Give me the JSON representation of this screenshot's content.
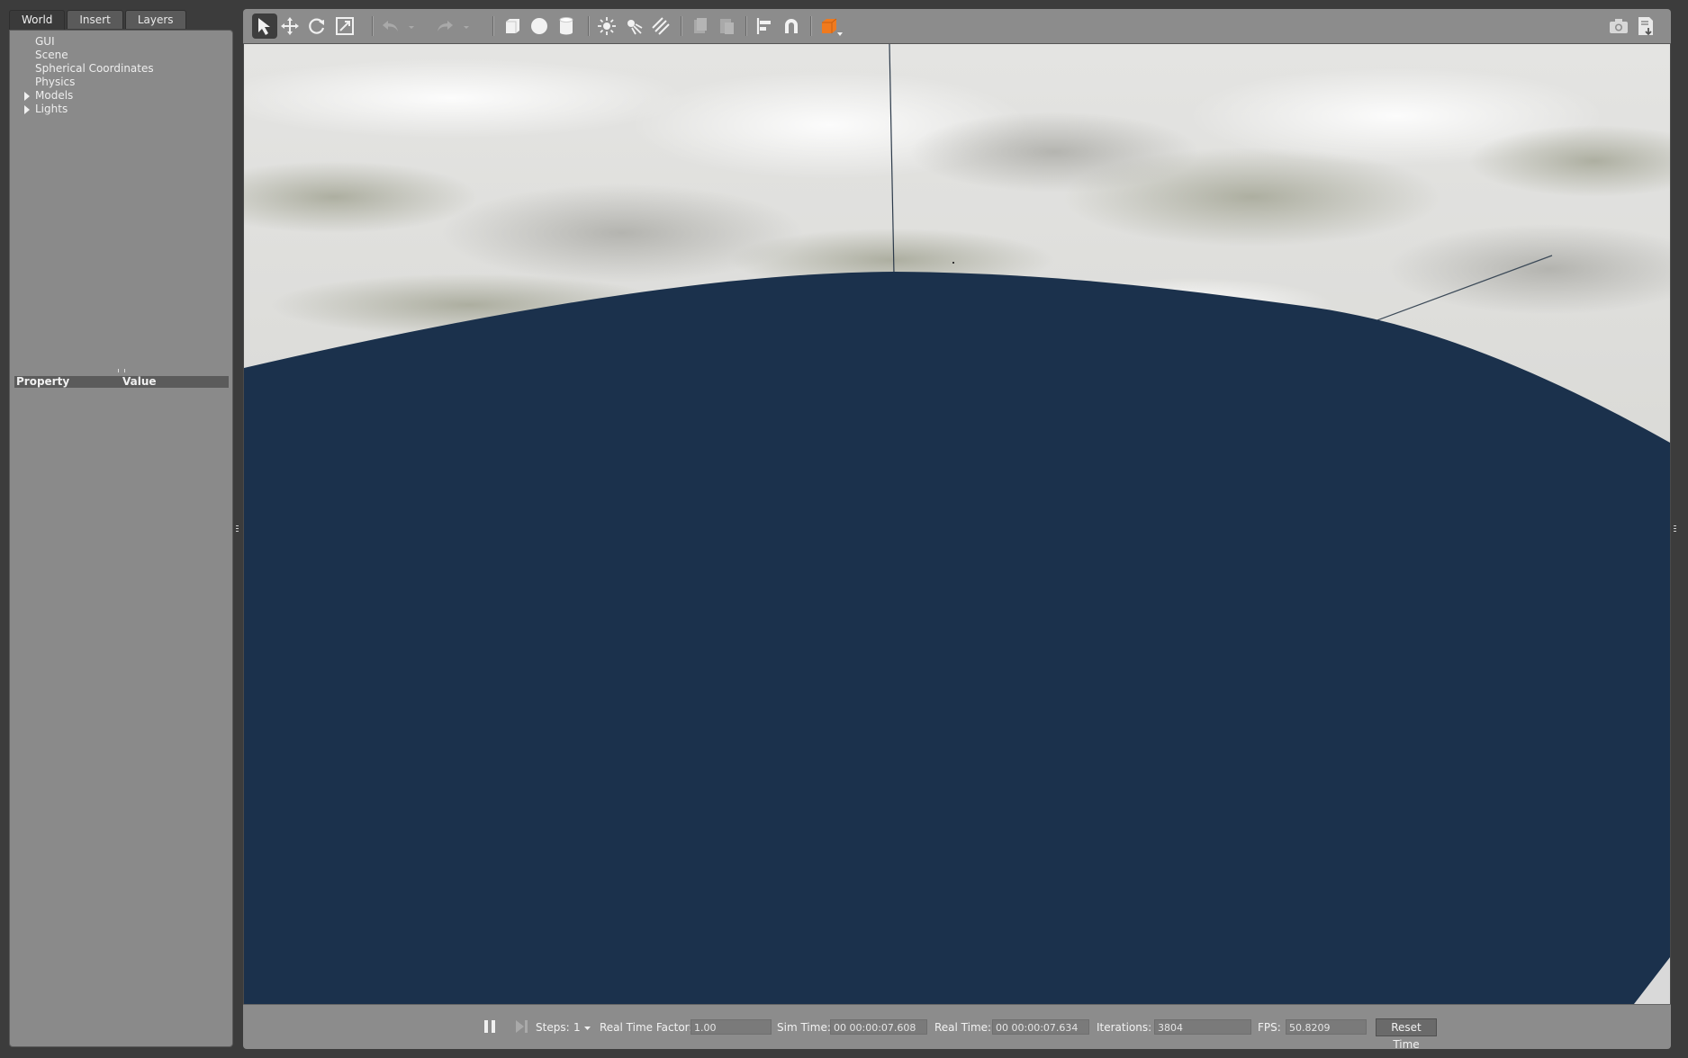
{
  "left_panel": {
    "tabs": [
      {
        "label": "World",
        "active": true
      },
      {
        "label": "Insert",
        "active": false
      },
      {
        "label": "Layers",
        "active": false
      }
    ],
    "tree": [
      {
        "label": "GUI",
        "expandable": false
      },
      {
        "label": "Scene",
        "expandable": false
      },
      {
        "label": "Spherical Coordinates",
        "expandable": false
      },
      {
        "label": "Physics",
        "expandable": false
      },
      {
        "label": "Models",
        "expandable": true
      },
      {
        "label": "Lights",
        "expandable": true
      }
    ],
    "property_header": {
      "property": "Property",
      "value": "Value"
    }
  },
  "toolbar": {
    "tools": [
      {
        "icon": "select-arrow-icon",
        "active": true
      },
      {
        "icon": "translate-icon"
      },
      {
        "icon": "rotate-icon"
      },
      {
        "icon": "scale-icon"
      },
      {
        "icon": "undo-icon"
      },
      {
        "icon": "undo-history-dropdown-icon"
      },
      {
        "icon": "redo-icon"
      },
      {
        "icon": "redo-history-dropdown-icon"
      },
      {
        "icon": "box-shape-icon"
      },
      {
        "icon": "sphere-shape-icon"
      },
      {
        "icon": "cylinder-shape-icon"
      },
      {
        "icon": "point-light-icon"
      },
      {
        "icon": "spot-light-icon"
      },
      {
        "icon": "directional-light-icon"
      },
      {
        "icon": "copy-icon"
      },
      {
        "icon": "paste-icon"
      },
      {
        "icon": "align-icon"
      },
      {
        "icon": "snap-magnet-icon"
      },
      {
        "icon": "view-angle-cube-icon"
      },
      {
        "icon": "screenshot-camera-icon"
      },
      {
        "icon": "log-record-icon"
      }
    ],
    "accent_color": "#f07a1e"
  },
  "viewport": {
    "sky_color": "#d9d9d9",
    "ground_color": "#1b314c"
  },
  "bottom_bar": {
    "steps_label": "Steps:",
    "steps_value": "1",
    "real_time_factor_label": "Real Time Factor:",
    "real_time_factor_value": "1.00",
    "sim_time_label": "Sim Time:",
    "sim_time_value": "00 00:00:07.608",
    "real_time_label": "Real Time:",
    "real_time_value": "00 00:00:07.634",
    "iterations_label": "Iterations:",
    "iterations_value": "3804",
    "fps_label": "FPS:",
    "fps_value": "50.8209",
    "reset_time_label": "Reset Time"
  }
}
